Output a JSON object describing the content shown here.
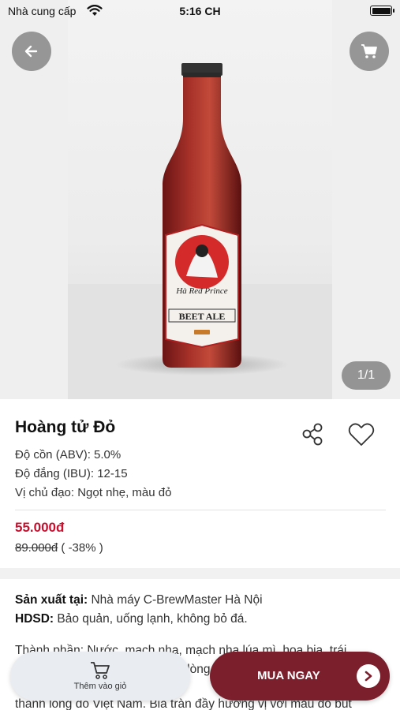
{
  "status_bar": {
    "carrier": "Nhà cung cấp",
    "time": "5:16 CH"
  },
  "gallery": {
    "counter": "1/1",
    "label_top": "Hà Red Prince",
    "label_bottom": "BEET ALE"
  },
  "product": {
    "name": "Hoàng tử Đỏ",
    "abv": "Độ cồn (ABV):  5.0%",
    "ibu": "Độ đắng (IBU): 12-15",
    "taste": "Vị chủ đạo: Ngọt nhẹ, màu đỏ",
    "price": "55.000đ",
    "old_price": "89.000đ",
    "discount": " ( -38% )"
  },
  "details": {
    "origin_label": "Sản xuất tại:",
    "origin_value": " Nhà máy C-BrewMaster Hà Nội",
    "usage_label": "HDSD:",
    "usage_value": " Bảo quản, uống lạnh, không bỏ đá.",
    "ingredients": "Thành phần: Nước, mạch nha, mạch nha lúa mì, hoa bia, trái",
    "line4": "dòng",
    "line5": "thanh long đỏ Việt Nam. Bia tràn đầy hương vị với màu đỏ bút"
  },
  "actions": {
    "add_to_cart": "Thêm vào giỏ",
    "buy_now": "MUA NGAY"
  },
  "colors": {
    "accent": "#7a1f2b",
    "price": "#c8102e",
    "button_bg": "#e9edf2"
  }
}
